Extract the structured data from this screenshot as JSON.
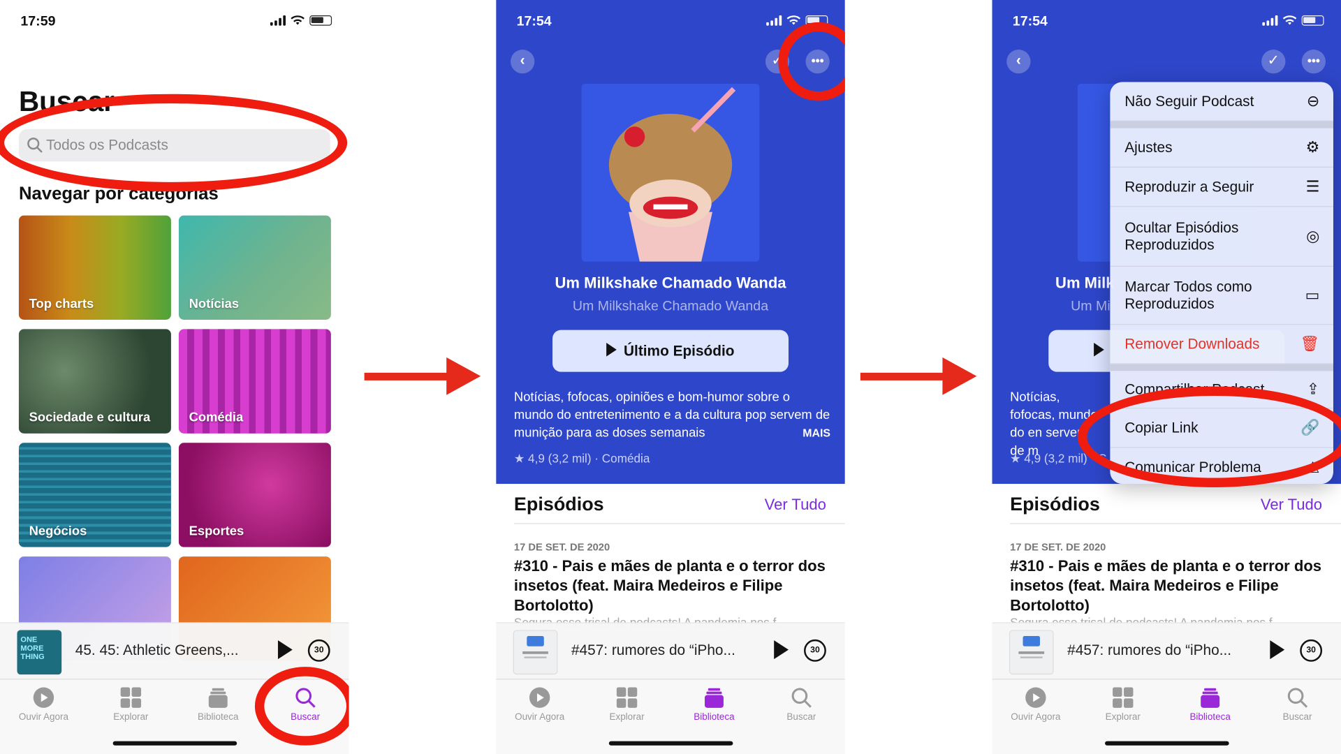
{
  "screen1": {
    "status": {
      "time": "17:59"
    },
    "title": "Buscar",
    "search_placeholder": "Todos os Podcasts",
    "section": "Navegar por categorias",
    "categories": [
      "Top charts",
      "Notícias",
      "Sociedade e cultura",
      "Comédia",
      "Negócios",
      "Esportes"
    ],
    "mini_player": {
      "title": "45. 45: Athletic Greens,...",
      "art_text": "ONE MORE THING",
      "skip": "30"
    },
    "tabs": [
      "Ouvir Agora",
      "Explorar",
      "Biblioteca",
      "Buscar"
    ],
    "active_tab": "Buscar"
  },
  "screen2": {
    "status": {
      "time": "17:54"
    },
    "podcast_title": "Um Milkshake Chamado Wanda",
    "podcast_author": "Um Milkshake Chamado Wanda",
    "latest_button": "Último Episódio",
    "description": "Notícias, fofocas, opiniões e bom-humor sobre o mundo do entretenimento e a da cultura pop servem de munição para as doses semanais",
    "more": "MAIS",
    "rating": "★ 4,9 (3,2 mil) · Comédia",
    "episodes_header": "Episódios",
    "see_all": "Ver Tudo",
    "episode": {
      "date": "17 DE SET. DE 2020",
      "title": "#310 - Pais e mães de planta e o terror dos insetos (feat. Maira Medeiros e Filipe Bortolotto)",
      "fragment": "Segura esse trisal de podcasts! A pandemia nos f..."
    },
    "mini_player": {
      "title": "#457: rumores do “iPho...",
      "skip": "30"
    },
    "tabs": [
      "Ouvir Agora",
      "Explorar",
      "Biblioteca",
      "Buscar"
    ],
    "active_tab": "Biblioteca"
  },
  "screen3": {
    "status": {
      "time": "17:54"
    },
    "partial_title": "Um Milk",
    "partial_author": "Um Mi",
    "partial_description": "Notícias, fofocas, mundo do en servem de m",
    "partial_rating": "★ 4,9 (3,2 mil) · C",
    "menu": [
      {
        "label": "Não Seguir Podcast",
        "icon": "minus-circle-icon"
      },
      {
        "label": "Ajustes",
        "icon": "gear-icon"
      },
      {
        "label": "Reproduzir a Seguir",
        "icon": "queue-icon"
      },
      {
        "label": "Ocultar Episódios Reproduzidos",
        "icon": "eye-slash-icon"
      },
      {
        "label": "Marcar Todos como Reproduzidos",
        "icon": "mark-played-icon"
      },
      {
        "label": "Remover Downloads",
        "icon": "trash-icon"
      },
      {
        "label": "Compartilhar Podcast",
        "icon": "share-icon"
      },
      {
        "label": "Copiar Link",
        "icon": "link-icon"
      },
      {
        "label": "Comunicar Problema",
        "icon": "report-icon"
      }
    ],
    "episodes_header": "Episódios",
    "see_all": "Ver Tudo",
    "episode": {
      "date": "17 DE SET. DE 2020",
      "title": "#310 - Pais e mães de planta e o terror dos insetos (feat. Maira Medeiros e Filipe Bortolotto)",
      "fragment": "Segura esse trisal de podcasts! A pandemia nos f..."
    },
    "mini_player": {
      "title": "#457: rumores do “iPho...",
      "skip": "30"
    },
    "tabs": [
      "Ouvir Agora",
      "Explorar",
      "Biblioteca",
      "Buscar"
    ],
    "active_tab": "Biblioteca"
  },
  "colors": {
    "accent": "#9a28d8",
    "highlight": "#ee1d0f",
    "podcast_bg": "#2e46c9",
    "danger": "#e0332a"
  }
}
